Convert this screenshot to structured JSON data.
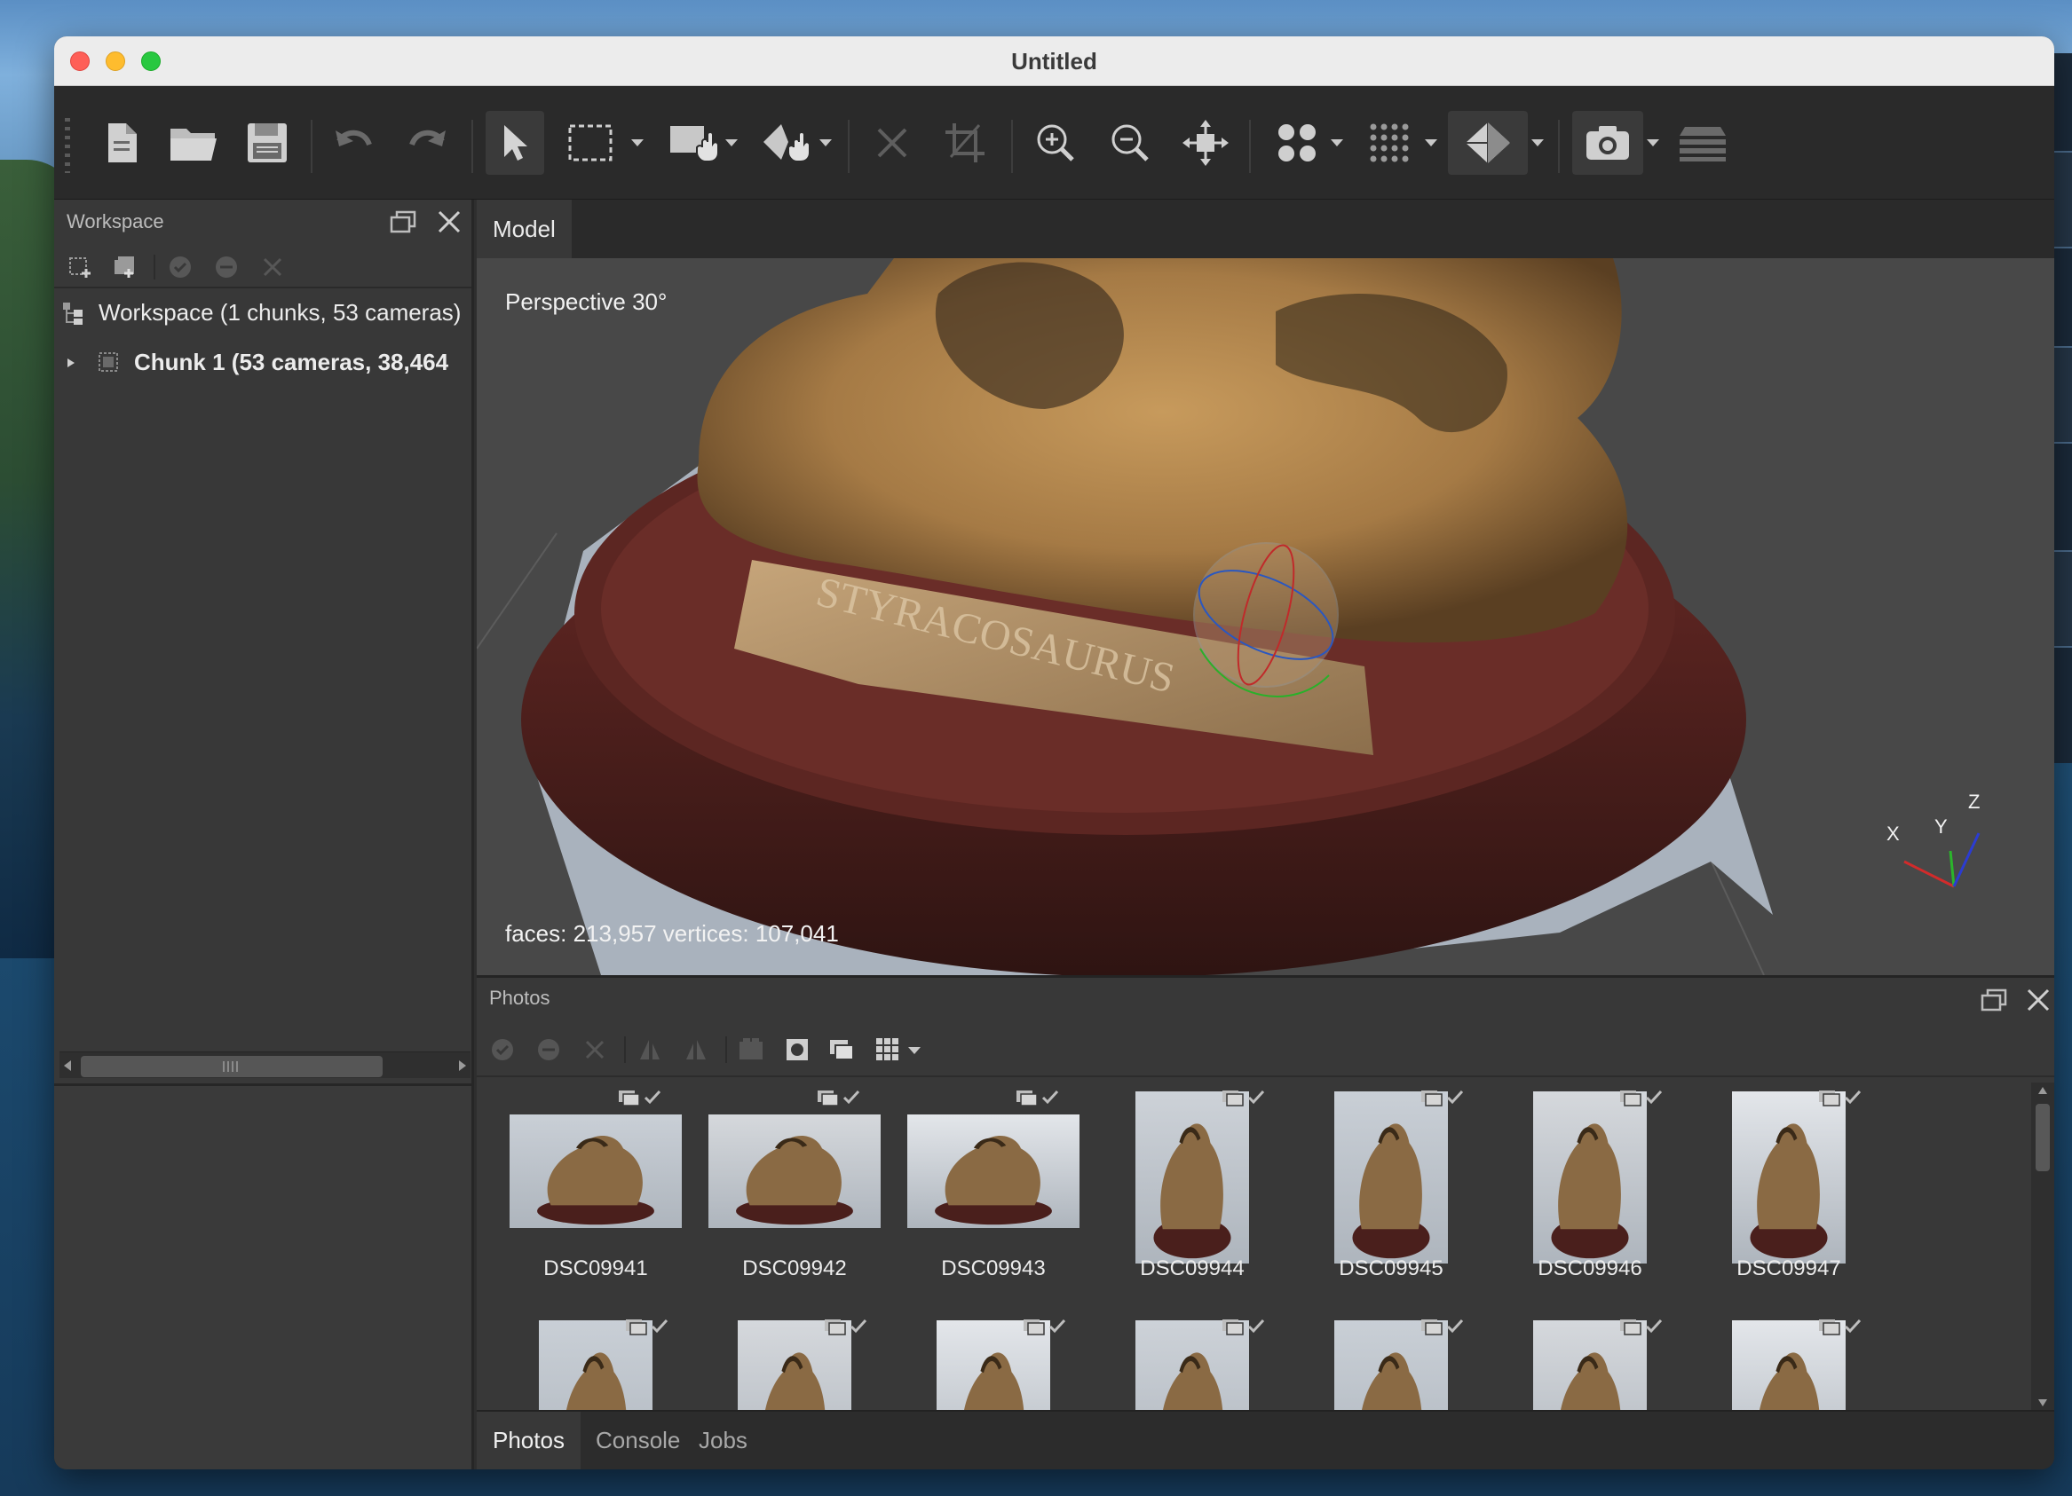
{
  "window": {
    "title": "Untitled"
  },
  "toolbar": {
    "buttons": [
      "new-document",
      "open-folder",
      "save",
      "undo",
      "redo",
      "select-arrow",
      "rect-selection",
      "resize-region",
      "rotate-region",
      "delete",
      "crop",
      "zoom-in",
      "zoom-out",
      "reset-view",
      "point-cloud",
      "dense-cloud",
      "model-view",
      "capture-view",
      "layers"
    ]
  },
  "workspace": {
    "title": "Workspace",
    "tree": [
      {
        "label": "Workspace (1 chunks, 53 cameras)"
      },
      {
        "label": "Chunk 1 (53 cameras, 38,464"
      }
    ]
  },
  "model": {
    "tab_label": "Model",
    "projection": "Perspective 30°",
    "stats": "faces: 213,957 vertices: 107,041",
    "axes": {
      "x": "X",
      "y": "Y",
      "z": "Z"
    },
    "plaque_text": "STYRACOSAURUS"
  },
  "photos": {
    "title": "Photos",
    "row1": [
      {
        "name": "DSC09941",
        "orient": "landscape"
      },
      {
        "name": "DSC09942",
        "orient": "landscape"
      },
      {
        "name": "DSC09943",
        "orient": "landscape"
      },
      {
        "name": "DSC09944",
        "orient": "portrait"
      },
      {
        "name": "DSC09945",
        "orient": "portrait"
      },
      {
        "name": "DSC09946",
        "orient": "portrait"
      },
      {
        "name": "DSC09947",
        "orient": "portrait"
      }
    ],
    "row2_count": 7
  },
  "bottom_tabs": [
    {
      "label": "Photos",
      "active": true
    },
    {
      "label": "Console",
      "active": false
    },
    {
      "label": "Jobs",
      "active": false
    }
  ],
  "colors": {
    "panel_bg": "#383838",
    "toolbar_bg": "#2a2a2a",
    "viewport_bg": "#484848",
    "axis_x": "#d22b2b",
    "axis_y": "#2bb52b",
    "axis_z": "#2b3cd2"
  }
}
